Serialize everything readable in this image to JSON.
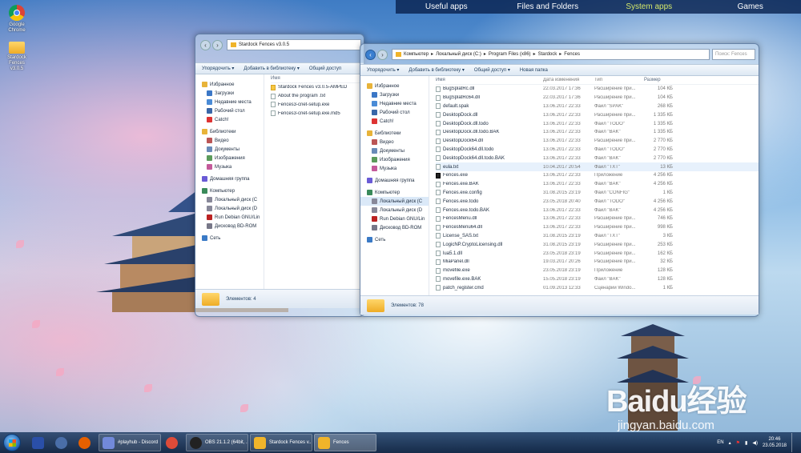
{
  "topbar": {
    "items": [
      {
        "label": "Useful apps",
        "active": false
      },
      {
        "label": "Files and Folders",
        "active": false
      },
      {
        "label": "System apps",
        "active": true
      },
      {
        "label": "Games",
        "active": false
      }
    ]
  },
  "desktop": {
    "icons": [
      {
        "label": "Google Chrome",
        "icon": "chrome-icon"
      },
      {
        "label": "Stardock Fences v3.0.5",
        "icon": "folder-icon"
      }
    ]
  },
  "window_left": {
    "path": "Stardock Fences v3.0.5",
    "toolbar": [
      "Упорядочить ▾",
      "Добавить в библиотеку ▾",
      "Общий доступ"
    ],
    "nav": [
      {
        "label": "Избранное",
        "head": true,
        "color": "#e8b339"
      },
      {
        "label": "Загрузки",
        "color": "#3b77c6"
      },
      {
        "label": "Недавние места",
        "color": "#4a8bd6"
      },
      {
        "label": "Рабочий стол",
        "color": "#3a67a8"
      },
      {
        "label": "Catch!",
        "color": "#d33"
      },
      {
        "label": "Библиотеки",
        "head": true,
        "color": "#e8b339"
      },
      {
        "label": "Видео",
        "color": "#b55"
      },
      {
        "label": "Документы",
        "color": "#6a8bb8"
      },
      {
        "label": "Изображения",
        "color": "#5b9b5b"
      },
      {
        "label": "Музыка",
        "color": "#c45a9a"
      },
      {
        "label": "Домашняя группа",
        "head": true,
        "color": "#6a5bd6"
      },
      {
        "label": "Компьютер",
        "head": true,
        "color": "#3a8a5a"
      },
      {
        "label": "Локальный диск (C",
        "color": "#889"
      },
      {
        "label": "Локальный диск (D",
        "color": "#889"
      },
      {
        "label": "Run Debian GNU/Lin",
        "color": "#b22"
      },
      {
        "label": "Дисковод BD-ROM",
        "color": "#778"
      },
      {
        "label": "Сеть",
        "head": true,
        "color": "#3a7ac6"
      }
    ],
    "col_name": "Имя",
    "files": [
      {
        "name": "Stardock Fences v3.0.5-AMPED",
        "kind": "folder"
      },
      {
        "name": "About the program .txt",
        "kind": "file"
      },
      {
        "name": "Fences3-cnet-setup.exe",
        "kind": "file"
      },
      {
        "name": "Fences3-cnet-setup.exe.md5",
        "kind": "file"
      }
    ],
    "status": "Элементов: 4"
  },
  "window_right": {
    "path": [
      "Компьютер",
      "Локальный диск (C:)",
      "Program Files (x86)",
      "Stardock",
      "Fences"
    ],
    "search_placeholder": "Поиск: Fences",
    "toolbar": [
      "Упорядочить ▾",
      "Добавить в библиотеку ▾",
      "Общий доступ ▾",
      "Новая папка"
    ],
    "nav": [
      {
        "label": "Избранное",
        "head": true,
        "color": "#e8b339"
      },
      {
        "label": "Загрузки",
        "color": "#3b77c6"
      },
      {
        "label": "Недавние места",
        "color": "#4a8bd6"
      },
      {
        "label": "Рабочий стол",
        "color": "#3a67a8"
      },
      {
        "label": "Catch!",
        "color": "#d33"
      },
      {
        "label": "Библиотеки",
        "head": true,
        "color": "#e8b339"
      },
      {
        "label": "Видео",
        "color": "#b55"
      },
      {
        "label": "Документы",
        "color": "#6a8bb8"
      },
      {
        "label": "Изображения",
        "color": "#5b9b5b"
      },
      {
        "label": "Музыка",
        "color": "#c45a9a"
      },
      {
        "label": "Домашняя группа",
        "head": true,
        "color": "#6a5bd6"
      },
      {
        "label": "Компьютер",
        "head": true,
        "color": "#3a8a5a"
      },
      {
        "label": "Локальный диск (C",
        "color": "#889",
        "selected": true
      },
      {
        "label": "Локальный диск (D",
        "color": "#889"
      },
      {
        "label": "Run Debian GNU/Lin",
        "color": "#b22"
      },
      {
        "label": "Дисковод BD-ROM",
        "color": "#778"
      },
      {
        "label": "Сеть",
        "head": true,
        "color": "#3a7ac6"
      }
    ],
    "columns": {
      "name": "Имя",
      "date": "Дата изменения",
      "type": "Тип",
      "size": "Размер"
    },
    "files": [
      {
        "name": "BugSplatRc.dll",
        "date": "22.03.2017 17:36",
        "type": "Расширение при...",
        "size": "104 КБ"
      },
      {
        "name": "BugSplatRc64.dll",
        "date": "22.03.2017 17:36",
        "type": "Расширение при...",
        "size": "104 КБ"
      },
      {
        "name": "default.spak",
        "date": "13.06.2017 22:33",
        "type": "Файл \"SPAK\"",
        "size": "268 КБ"
      },
      {
        "name": "DesktopDock.dll",
        "date": "13.06.2017 22:33",
        "type": "Расширение при...",
        "size": "1 335 КБ"
      },
      {
        "name": "DesktopDock.dll.todo",
        "date": "13.06.2017 22:33",
        "type": "Файл \"TODO\"",
        "size": "1 335 КБ"
      },
      {
        "name": "DesktopDock.dll.todo.BAK",
        "date": "13.06.2017 22:33",
        "type": "Файл \"BAK\"",
        "size": "1 335 КБ"
      },
      {
        "name": "DesktopDock64.dll",
        "date": "13.06.2017 22:33",
        "type": "Расширение при...",
        "size": "2 770 КБ"
      },
      {
        "name": "DesktopDock64.dll.todo",
        "date": "13.06.2017 22:33",
        "type": "Файл \"TODO\"",
        "size": "2 770 КБ"
      },
      {
        "name": "DesktopDock64.dll.todo.BAK",
        "date": "13.06.2017 22:33",
        "type": "Файл \"BAK\"",
        "size": "2 770 КБ"
      },
      {
        "name": "eula.txt",
        "date": "10.04.2017 20:54",
        "type": "Файл \"TXT\"",
        "size": "13 КБ",
        "highlight": true
      },
      {
        "name": "Fences.exe",
        "date": "13.06.2017 22:33",
        "type": "Приложение",
        "size": "4 256 КБ",
        "kind": "exe"
      },
      {
        "name": "Fences.exe.BAK",
        "date": "13.06.2017 22:33",
        "type": "Файл \"BAK\"",
        "size": "4 256 КБ"
      },
      {
        "name": "Fences.exe.config",
        "date": "31.08.2015 23:19",
        "type": "Файл \"CONFIG\"",
        "size": "1 КБ"
      },
      {
        "name": "Fences.exe.todo",
        "date": "23.05.2018 20:40",
        "type": "Файл \"TODO\"",
        "size": "4 256 КБ"
      },
      {
        "name": "Fences.exe.todo.BAK",
        "date": "13.06.2017 22:33",
        "type": "Файл \"BAK\"",
        "size": "4 256 КБ"
      },
      {
        "name": "FencesMenu.dll",
        "date": "13.06.2017 22:33",
        "type": "Расширение при...",
        "size": "746 КБ"
      },
      {
        "name": "FencesMenu64.dll",
        "date": "13.06.2017 22:33",
        "type": "Расширение при...",
        "size": "998 КБ"
      },
      {
        "name": "License_SAS.txt",
        "date": "31.08.2015 23:19",
        "type": "Файл \"TXT\"",
        "size": "3 КБ"
      },
      {
        "name": "LogicNP.CryptoLicensing.dll",
        "date": "31.08.2015 23:19",
        "type": "Расширение при...",
        "size": "253 КБ"
      },
      {
        "name": "lua5.1.dll",
        "date": "23.05.2018 23:19",
        "type": "Расширение при...",
        "size": "162 КБ"
      },
      {
        "name": "MiaPanel.dll",
        "date": "19.03.2017 20:26",
        "type": "Расширение при...",
        "size": "32 КБ"
      },
      {
        "name": "movefile.exe",
        "date": "23.05.2018 23:19",
        "type": "Приложение",
        "size": "128 КБ"
      },
      {
        "name": "movefile.exe.BAK",
        "date": "15.05.2018 23:19",
        "type": "Файл \"BAK\"",
        "size": "128 КБ"
      },
      {
        "name": "patch_register.cmd",
        "date": "01.09.2013 12:33",
        "type": "Сценарий Windo...",
        "size": "1 КБ"
      }
    ],
    "status": "Элементов: 78"
  },
  "taskbar": {
    "items": [
      {
        "label": "",
        "icon": "save-disk-icon",
        "color": "#2a4fa8"
      },
      {
        "label": "",
        "icon": "edge-icon",
        "color": "#4a6ea8"
      },
      {
        "label": "",
        "icon": "firefox-icon",
        "color": "#e66000"
      },
      {
        "label": "#playhub - Discord",
        "icon": "discord-icon",
        "color": "#7289da",
        "boxed": true
      },
      {
        "label": "",
        "icon": "chrome-icon",
        "color": "#dd4b39"
      },
      {
        "label": "OBS 21.1.2 (64bit, ...",
        "icon": "obs-icon",
        "color": "#222",
        "boxed": true
      },
      {
        "label": "Stardock Fences v...",
        "icon": "folder-icon",
        "color": "#f0b42a",
        "boxed": true
      },
      {
        "label": "Fences",
        "icon": "folder-icon",
        "color": "#f0b42a",
        "boxed": true,
        "active": true
      }
    ],
    "lang": "EN",
    "time": "20:46",
    "date": "23.05.2018"
  },
  "watermark": {
    "main": "Baidu经验",
    "sub": "jingyan.baidu.com"
  }
}
